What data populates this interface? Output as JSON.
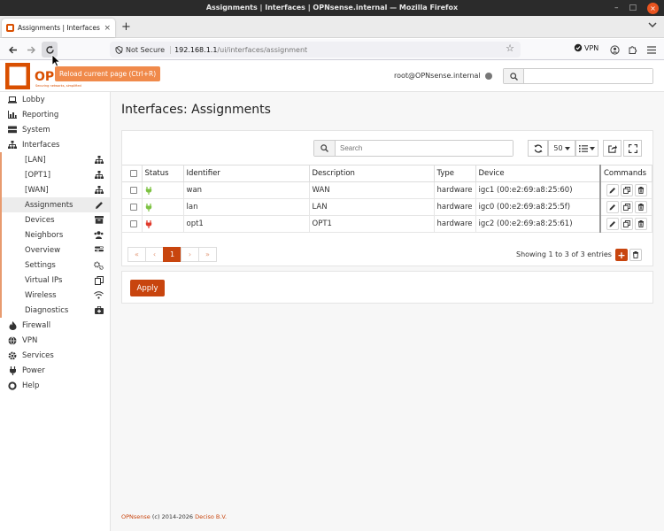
{
  "window": {
    "title": "Assignments | Interfaces | OPNsense.internal — Mozilla Firefox",
    "controls": [
      "–",
      "□",
      "×"
    ]
  },
  "browser": {
    "tab_title": "Assignments | Interfaces | C",
    "new_tab": "+",
    "tab_close": "×",
    "security_label": "Not Secure",
    "url_host": "192.168.1.1",
    "url_path": "/ui/interfaces/assignment",
    "vpn_label": "VPN",
    "tooltip": "Reload current page (Ctrl+R)"
  },
  "header": {
    "logo_text": "OPN",
    "logo_sub": "Securing networks, simplified",
    "user": "root@OPNsense.internal",
    "search_placeholder": ""
  },
  "sidebar": {
    "items_top": [
      {
        "label": "Lobby",
        "icon": "laptop-icon"
      },
      {
        "label": "Reporting",
        "icon": "chart-icon"
      },
      {
        "label": "System",
        "icon": "server-icon"
      },
      {
        "label": "Interfaces",
        "icon": "sitemap-icon"
      }
    ],
    "submenu": [
      {
        "label": "[LAN]",
        "icon": "sitemap-icon",
        "active": false
      },
      {
        "label": "[OPT1]",
        "icon": "sitemap-icon",
        "active": false
      },
      {
        "label": "[WAN]",
        "icon": "sitemap-icon",
        "active": false
      },
      {
        "label": "Assignments",
        "icon": "pencil-icon",
        "active": true
      },
      {
        "label": "Devices",
        "icon": "archive-icon",
        "active": false
      },
      {
        "label": "Neighbors",
        "icon": "users-icon",
        "active": false
      },
      {
        "label": "Overview",
        "icon": "tasks-icon",
        "active": false
      },
      {
        "label": "Settings",
        "icon": "cogs-icon",
        "active": false
      },
      {
        "label": "Virtual IPs",
        "icon": "copy-icon",
        "active": false
      },
      {
        "label": "Wireless",
        "icon": "wifi-icon",
        "active": false
      },
      {
        "label": "Diagnostics",
        "icon": "medkit-icon",
        "active": false
      }
    ],
    "items_bottom": [
      {
        "label": "Firewall",
        "icon": "fire-icon"
      },
      {
        "label": "VPN",
        "icon": "globe-icon"
      },
      {
        "label": "Services",
        "icon": "gear-icon"
      },
      {
        "label": "Power",
        "icon": "plug-icon"
      },
      {
        "label": "Help",
        "icon": "lifebuoy-icon"
      }
    ]
  },
  "main": {
    "title": "Interfaces: Assignments",
    "search_placeholder": "Search",
    "page_size": "50",
    "columns": [
      "Status",
      "Identifier",
      "Description",
      "Type",
      "Device",
      "Commands"
    ],
    "rows": [
      {
        "status": "up",
        "status_color": "#7dc242",
        "identifier": "wan",
        "description": "WAN",
        "type": "hardware",
        "device": "igc1 (00:e2:69:a8:25:60)"
      },
      {
        "status": "up",
        "status_color": "#7dc242",
        "identifier": "lan",
        "description": "LAN",
        "type": "hardware",
        "device": "igc0 (00:e2:69:a8:25:5f)"
      },
      {
        "status": "down",
        "status_color": "#e0392b",
        "identifier": "opt1",
        "description": "OPT1",
        "type": "hardware",
        "device": "igc2 (00:e2:69:a8:25:61)"
      }
    ],
    "pager": [
      "«",
      "‹",
      "1",
      "›",
      "»"
    ],
    "pager_current": "1",
    "entries_info": "Showing 1 to 3 of 3 entries",
    "apply_label": "Apply"
  },
  "footer": {
    "product": "OPNsense",
    "copyright": " (c) 2014-2026 ",
    "company": "Deciso B.V."
  },
  "colors": {
    "accent": "#c8450e",
    "sidebar_rule": "#e89b6f",
    "up": "#7dc242",
    "down": "#e0392b"
  }
}
